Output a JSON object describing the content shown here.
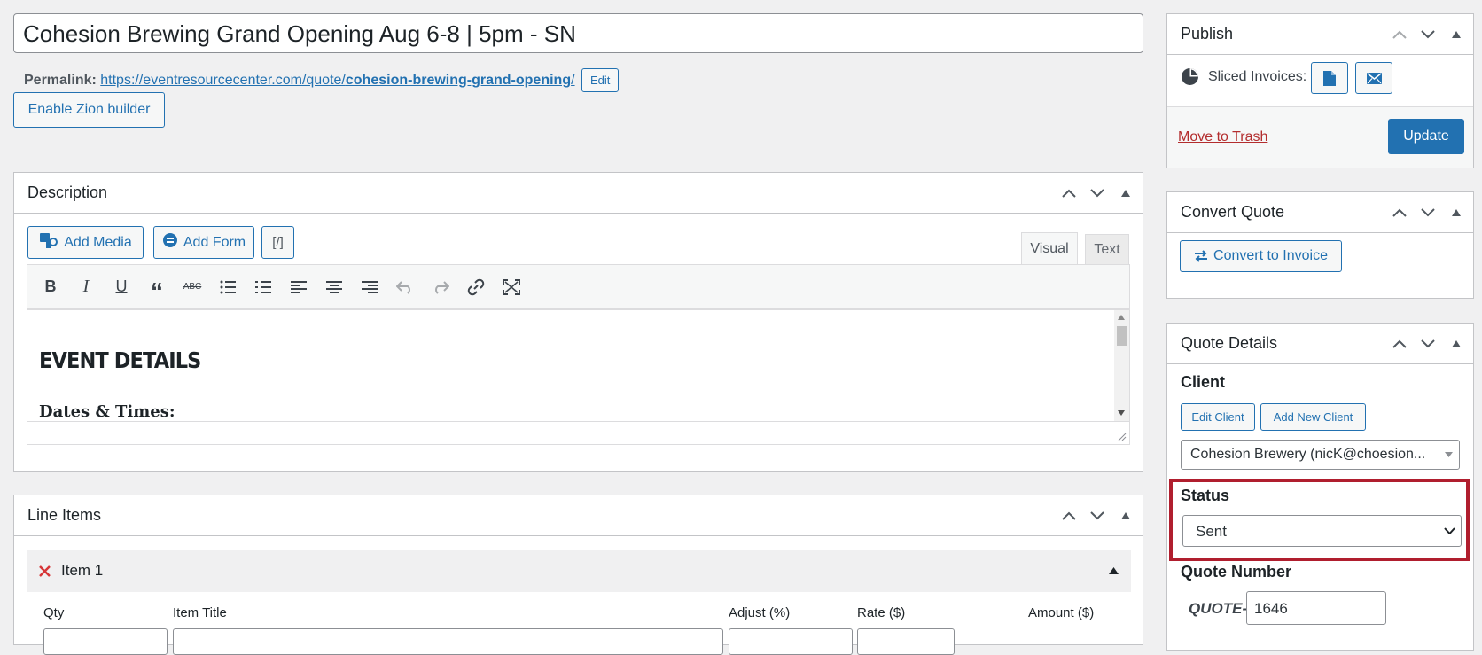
{
  "post": {
    "title": "Cohesion Brewing Grand Opening Aug 6-8 | 5pm - SN",
    "permalink_label": "Permalink:",
    "permalink_base": "https://eventresourcecenter.com/quote/",
    "permalink_slug": "cohesion-brewing-grand-opening",
    "permalink_trail": "/",
    "permalink_edit": "Edit",
    "zion_button": "Enable Zion builder"
  },
  "description": {
    "title": "Description",
    "add_media": "Add Media",
    "add_form": "Add Form",
    "shortcode_glyph": "[/]",
    "tab_visual": "Visual",
    "tab_text": "Text",
    "content_heading": "EVENT DETAILS",
    "content_subheading": "Dates & Times:"
  },
  "line_items": {
    "title": "Line Items",
    "item_label": "Item 1",
    "columns": [
      "Qty",
      "Item Title",
      "Adjust (%)",
      "Rate ($)",
      "Amount ($)"
    ]
  },
  "publish": {
    "title": "Publish",
    "sliced_label": "Sliced Invoices:",
    "trash": "Move to Trash",
    "update": "Update"
  },
  "convert": {
    "title": "Convert Quote",
    "button": "Convert to Invoice"
  },
  "quote_details": {
    "title": "Quote Details",
    "client_label": "Client",
    "edit_client": "Edit Client",
    "add_client": "Add New Client",
    "client_value": "Cohesion Brewery (nicK@choesion...",
    "status_label": "Status",
    "status_value": "Sent",
    "number_label": "Quote Number",
    "number_prefix": "QUOTE-",
    "number_value": "1646"
  },
  "colors": {
    "accent": "#2271b1",
    "highlight": "#b01e2e",
    "danger": "#b32d2e"
  }
}
